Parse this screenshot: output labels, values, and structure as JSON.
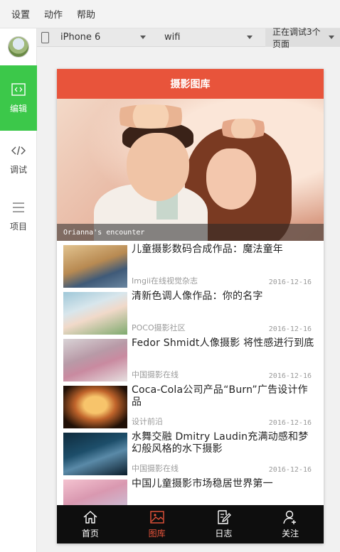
{
  "menu": [
    "设置",
    "动作",
    "帮助"
  ],
  "sidebar": {
    "items": [
      {
        "label": "编辑",
        "icon": "code-icon",
        "active": true
      },
      {
        "label": "调试",
        "icon": "code-debug-icon",
        "active": false
      },
      {
        "label": "项目",
        "icon": "menu-lines-icon",
        "active": false
      }
    ]
  },
  "toolbar": {
    "device": "iPhone 6",
    "network": "wifi",
    "pages": "正在调试3个页面"
  },
  "app": {
    "title": "摄影图库",
    "banner_caption": "Orianna's encounter",
    "articles": [
      {
        "title": "儿童摄影数码合成作品：魔法童年",
        "source": "Imgii在线视觉杂志",
        "date": "2016-12-16"
      },
      {
        "title": "清新色调人像作品：你的名字",
        "source": "POCO摄影社区",
        "date": "2016-12-16"
      },
      {
        "title": "Fedor Shmidt人像摄影 将性感进行到底",
        "source": "中国摄影在线",
        "date": "2016-12-16"
      },
      {
        "title": "Coca-Cola公司产品“Burn”广告设计作品",
        "source": "设计前沿",
        "date": "2016-12-16"
      },
      {
        "title": "水舞交融 Dmitry Laudin充满动感和梦幻般风格的水下摄影",
        "source": "中国摄影在线",
        "date": "2016-12-16"
      },
      {
        "title": "中国儿童摄影市场稳居世界第一",
        "source": "",
        "date": ""
      }
    ],
    "tabs": [
      {
        "label": "首页",
        "icon": "home-icon"
      },
      {
        "label": "图库",
        "icon": "gallery-icon"
      },
      {
        "label": "日志",
        "icon": "edit-log-icon"
      },
      {
        "label": "关注",
        "icon": "add-user-icon"
      }
    ],
    "accent_color": "#e8543b"
  }
}
